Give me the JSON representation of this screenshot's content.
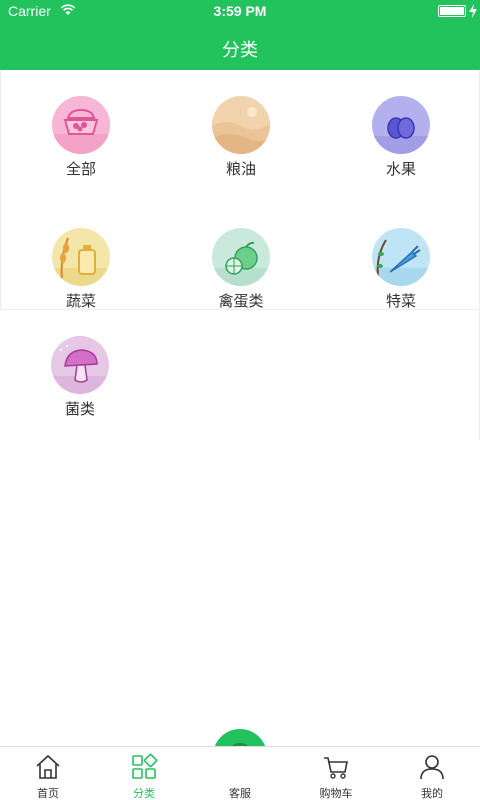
{
  "status": {
    "carrier": "Carrier",
    "time": "3:59 PM"
  },
  "header": {
    "title": "分类"
  },
  "categories": [
    {
      "label": "全部",
      "icon": "basket-icon",
      "color": "#f8b6d6"
    },
    {
      "label": "粮油",
      "icon": "desert-dunes-icon",
      "color": "#f1d3ad"
    },
    {
      "label": "水果",
      "icon": "plum-fruit-icon",
      "color": "#b3b0f0"
    },
    {
      "label": "蔬菜",
      "icon": "wheat-oil-bottle-icon",
      "color": "#f3e6a8"
    },
    {
      "label": "禽蛋类",
      "icon": "citrus-fruit-icon",
      "color": "#c9e9dc"
    },
    {
      "label": "特菜",
      "icon": "carrot-icon",
      "color": "#bfe4f5"
    },
    {
      "label": "菌类",
      "icon": "mushroom-icon",
      "color": "#e6c7e6"
    }
  ],
  "tabbar": {
    "home": "首页",
    "category": "分类",
    "service": "客服",
    "cart": "购物车",
    "mine": "我的"
  },
  "colors": {
    "accent": "#22c35d"
  }
}
